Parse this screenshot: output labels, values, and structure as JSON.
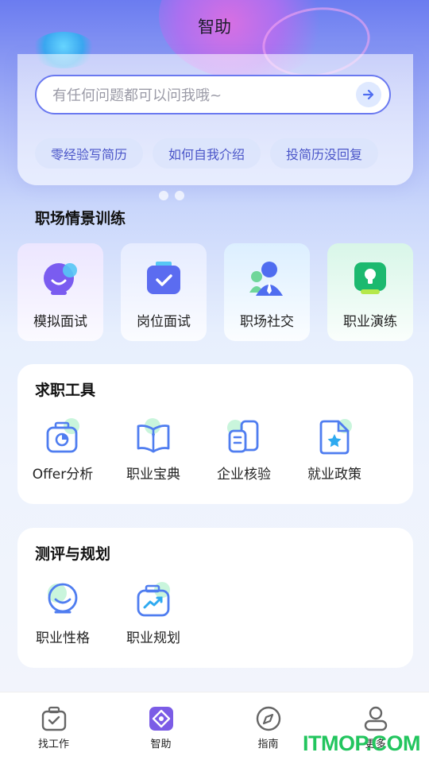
{
  "header": {
    "title": "智助"
  },
  "search": {
    "placeholder": "有任何问题都可以问我哦~"
  },
  "chips": [
    "零经验写简历",
    "如何自我介绍",
    "投简历没回复"
  ],
  "scene_training": {
    "title": "职场情景训练",
    "items": [
      {
        "label": "模拟面试",
        "icon": "interview-bubble-icon"
      },
      {
        "label": "岗位面试",
        "icon": "checked-briefcase-icon"
      },
      {
        "label": "职场社交",
        "icon": "people-icon"
      },
      {
        "label": "职业演练",
        "icon": "lightbulb-icon"
      }
    ]
  },
  "job_tools": {
    "title": "求职工具",
    "items": [
      {
        "label": "Offer分析",
        "icon": "offer-chart-icon"
      },
      {
        "label": "职业宝典",
        "icon": "career-book-icon"
      },
      {
        "label": "企业核验",
        "icon": "company-verify-icon"
      },
      {
        "label": "就业政策",
        "icon": "policy-doc-icon"
      }
    ]
  },
  "assessment": {
    "title": "测评与规划",
    "items": [
      {
        "label": "职业性格",
        "icon": "personality-face-icon"
      },
      {
        "label": "职业规划",
        "icon": "planning-trend-icon"
      }
    ]
  },
  "nav": {
    "items": [
      {
        "label": "找工作",
        "icon": "briefcase-icon",
        "active": false
      },
      {
        "label": "智助",
        "icon": "assistant-icon",
        "active": true
      },
      {
        "label": "指南",
        "icon": "compass-icon",
        "active": false
      },
      {
        "label": "更多",
        "icon": "user-icon",
        "active": false
      }
    ]
  },
  "watermark": "ITMOP.COM",
  "colors": {
    "accent": "#6a79f0",
    "chip_text": "#4a55c8",
    "active_nav": "#7b5ce6",
    "watermark": "#22c55e"
  }
}
